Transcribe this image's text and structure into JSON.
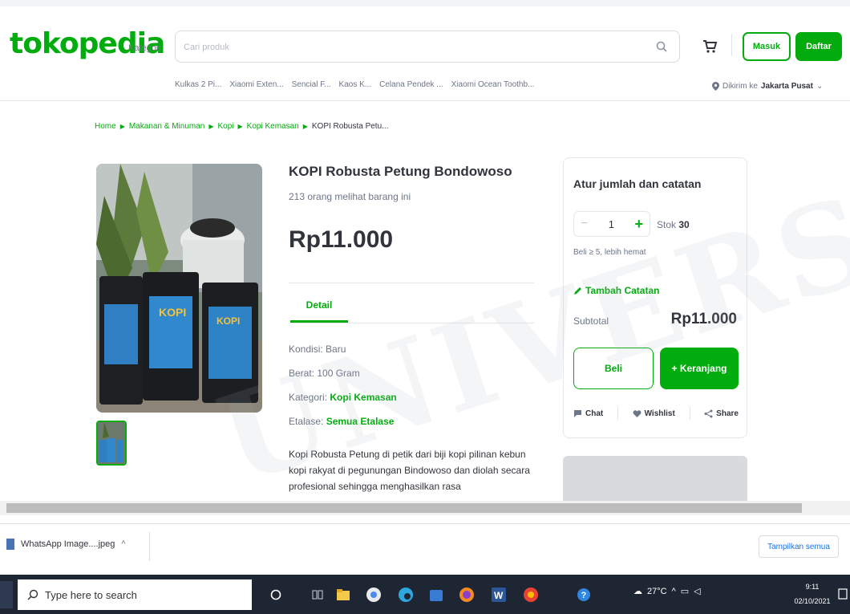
{
  "header": {
    "logo": "tokopedia",
    "kategori": "Kategori",
    "search_placeholder": "Cari produk",
    "login_label": "Masuk",
    "register_label": "Daftar",
    "suggestions": [
      "Kulkas 2 Pi...",
      "Xiaomi Exten...",
      "Sencial F...",
      "Kaos K...",
      "Celana Pendek ...",
      "Xiaomi Ocean Toothb..."
    ],
    "location_prefix": "Dikirim ke",
    "location_value": "Jakarta Pusat"
  },
  "breadcrumb": [
    "Home",
    "Makanan & Minuman",
    "Kopi",
    "Kopi Kemasan",
    "KOPI Robusta Petu..."
  ],
  "product": {
    "title": "KOPI Robusta Petung Bondowoso",
    "views": "213 orang melihat barang ini",
    "price": "Rp11.000",
    "tab_detail": "Detail",
    "kondisi_label": "Kondisi:",
    "kondisi_value": "Baru",
    "berat_label": "Berat:",
    "berat_value": "100 Gram",
    "kategori_label": "Kategori:",
    "kategori_value": "Kopi Kemasan",
    "etalase_label": "Etalase:",
    "etalase_value": "Semua Etalase",
    "description": "Kopi Robusta Petung di petik dari biji kopi pilinan kebun kopi rakyat di pegunungan Bindowoso dan diolah secara profesional sehingga menghasilkan rasa"
  },
  "order_card": {
    "title": "Atur jumlah dan catatan",
    "quantity": "1",
    "stock_label": "Stok",
    "stock_value": "30",
    "bulk_note": "Beli ≥ 5, lebih hemat",
    "add_note": "Tambah Catatan",
    "subtotal_label": "Subtotal",
    "subtotal_value": "Rp11.000",
    "buy_label": "Beli",
    "cart_label": "+ Keranjang",
    "chat_label": "Chat",
    "wishlist_label": "Wishlist",
    "share_label": "Share"
  },
  "download_bar": {
    "file_name": "WhatsApp Image....jpeg",
    "show_all": "Tampilkan semua"
  },
  "taskbar": {
    "search_placeholder": "Type here to search",
    "temperature": "27°C",
    "time": "9:11",
    "date": "02/10/2021"
  },
  "colors": {
    "brand": "#03ac0e",
    "taskbar": "#1f2633"
  }
}
